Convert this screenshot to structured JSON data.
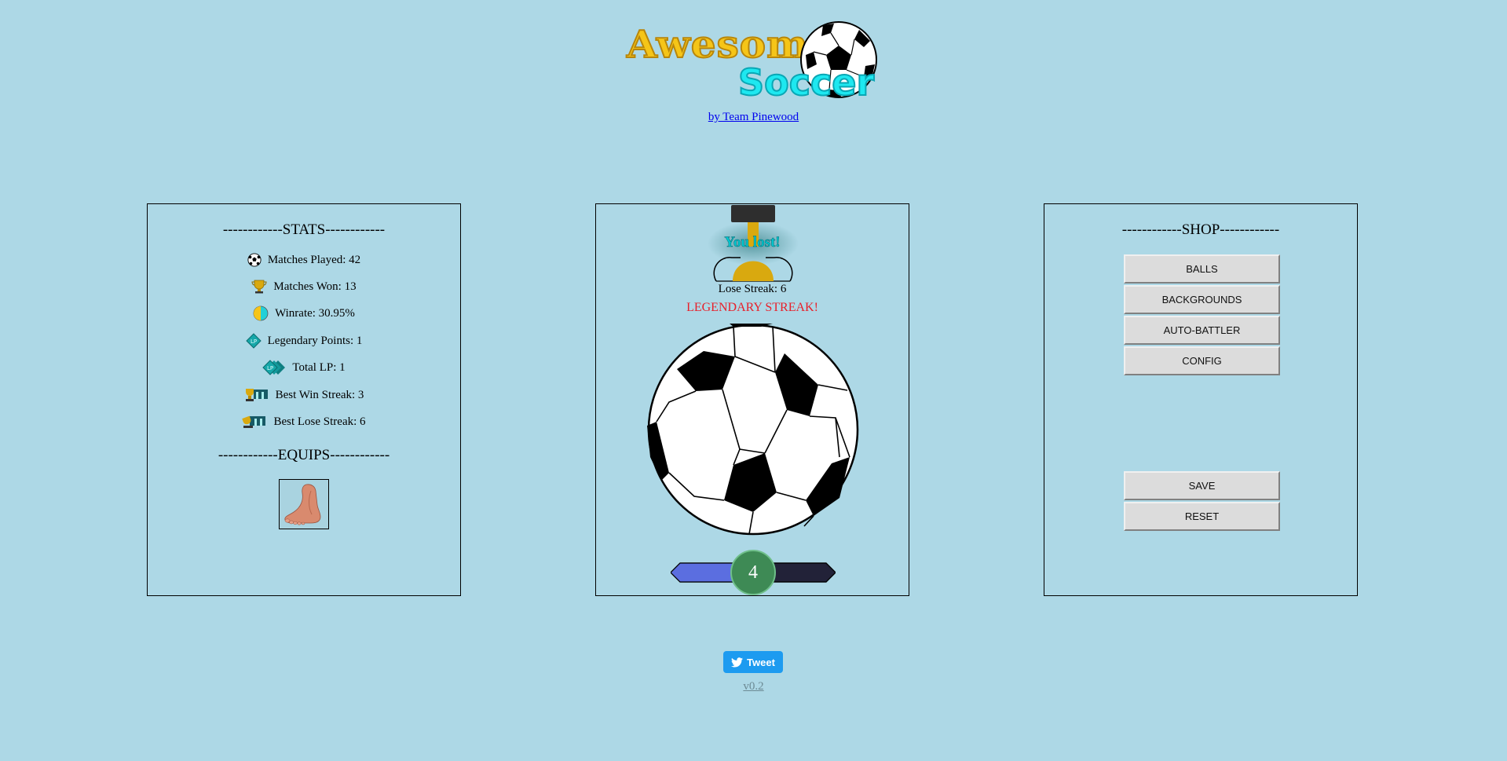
{
  "header": {
    "logo_word1": "Awesome",
    "logo_word2": "Soccer",
    "byline": "by Team Pinewood"
  },
  "stats": {
    "heading": "------------STATS------------",
    "items": [
      {
        "icon": "soccer-ball-icon",
        "text": "Matches Played: 42"
      },
      {
        "icon": "trophy-icon",
        "text": "Matches Won: 13"
      },
      {
        "icon": "winrate-icon",
        "text": "Winrate: 30.95%"
      },
      {
        "icon": "lp-diamond-icon",
        "text": "Legendary Points: 1"
      },
      {
        "icon": "lp-stack-icon",
        "text": "Total LP: 1"
      },
      {
        "icon": "win-streak-icon",
        "text": "Best Win Streak: 3"
      },
      {
        "icon": "lose-streak-icon",
        "text": "Best Lose Streak: 6"
      }
    ],
    "equips_heading": "------------EQUIPS------------",
    "equip_item": "foot-icon"
  },
  "game": {
    "result": "You lost!",
    "lose_streak": "Lose Streak: 6",
    "legendary": "LEGENDARY STREAK!",
    "level": "4",
    "progress_fraction": 0.6,
    "colors": {
      "progress_fill": "#5b6ee0",
      "progress_track": "#222238",
      "level_badge": "#3e8a55"
    }
  },
  "shop": {
    "heading": "------------SHOP------------",
    "buttons": [
      "BALLS",
      "BACKGROUNDS",
      "AUTO-BATTLER",
      "CONFIG"
    ],
    "save": "SAVE",
    "reset": "RESET"
  },
  "footer": {
    "tweet": "Tweet",
    "version": "v0.2"
  },
  "colors": {
    "background": "#add8e6"
  }
}
